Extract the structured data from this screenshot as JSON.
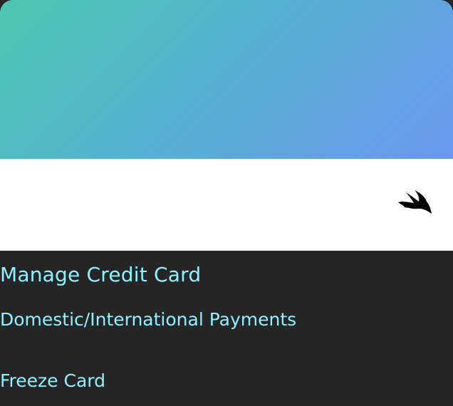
{
  "card": {
    "gradient_start": "#4cc8b1",
    "gradient_end": "#6b98ef",
    "logo_icon": "swift-bird-icon"
  },
  "menu": {
    "title": "Manage Credit Card",
    "items": [
      {
        "label": "Domestic/International Payments"
      },
      {
        "label": "Freeze Card"
      }
    ],
    "text_color": "#8ff1ff",
    "background": "#252525"
  }
}
